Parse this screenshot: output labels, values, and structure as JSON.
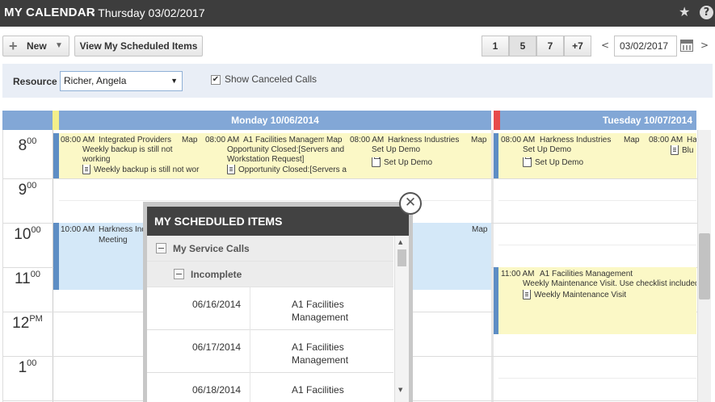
{
  "header": {
    "title": "MY CALENDAR",
    "subtitle": "- Thursday 03/02/2017"
  },
  "toolbar": {
    "new_label": "New",
    "view_scheduled_label": "View My Scheduled Items",
    "day_counts": [
      "1",
      "5",
      "7",
      "+7"
    ],
    "prev": "<",
    "next": ">",
    "date_value": "03/02/2017"
  },
  "filters": {
    "resource_label": "Resource",
    "resource_value": "Richer, Angela",
    "show_canceled_label": "Show Canceled Calls",
    "show_canceled_checked": true
  },
  "calendar": {
    "days": [
      {
        "label": "Monday 10/06/2014",
        "marker_color": "#f3ef8a"
      },
      {
        "label": "Tuesday 10/07/2014",
        "marker_color": "#e74b4b"
      }
    ],
    "hours": [
      {
        "h": "8",
        "s": "00"
      },
      {
        "h": "9",
        "s": "00"
      },
      {
        "h": "10",
        "s": "00"
      },
      {
        "h": "11",
        "s": "00"
      },
      {
        "h": "12",
        "s": "PM"
      },
      {
        "h": "1",
        "s": "00"
      }
    ],
    "events": {
      "mon_a": {
        "time": "08:00 AM",
        "title": "Integrated Providers",
        "desc1": "Weekly backup is still not",
        "desc2": "working",
        "sub": "Weekly backup is still not wor",
        "map": "Map"
      },
      "mon_b": {
        "time": "08:00 AM",
        "title": "A1 Facilities Managem",
        "desc1": "Opportunity Closed:[Servers and",
        "desc2": "Workstation Request]",
        "sub": "Opportunity Closed:[Servers a",
        "map": "Map"
      },
      "mon_c": {
        "time": "08:00 AM",
        "title": "Harkness Industries",
        "desc1": "Set Up Demo",
        "sub": "Set Up Demo",
        "map": "Map"
      },
      "mon_d": {
        "time": "10:00 AM",
        "title": "Harkness Ind",
        "desc1": "Meeting",
        "map": "Map"
      },
      "tue_a": {
        "time": "08:00 AM",
        "title": "Harkness Industries",
        "desc1": "Set Up Demo",
        "sub": "Set Up Demo",
        "map": "Map"
      },
      "tue_b": {
        "time": "08:00 AM",
        "title": "Ha",
        "sub": "Blu"
      },
      "tue_c": {
        "time": "11:00 AM",
        "title": "A1 Facilities Management",
        "desc1": "Weekly Maintenance Visit. Use checklist included",
        "sub": "Weekly Maintenance Visit"
      }
    }
  },
  "popup": {
    "title": "MY SCHEDULED ITEMS",
    "close": "✕",
    "group": "My Service Calls",
    "subgroup": "Incomplete",
    "rows": [
      {
        "date": "06/16/2014",
        "name": "A1 Facilities Management"
      },
      {
        "date": "06/17/2014",
        "name": "A1 Facilities Management"
      },
      {
        "date": "06/18/2014",
        "name": "A1 Facilities"
      }
    ]
  },
  "colors": {
    "appt_yellow": "#fbf8c6",
    "appt_blue": "#d4e8f8",
    "stripe_blue": "#5d8dc4",
    "header_blue": "#82a7d6"
  },
  "icons": [
    "star-icon",
    "help-icon",
    "plus-icon",
    "dropdown-arrow-icon",
    "calendar-icon",
    "document-icon",
    "clipboard-icon",
    "close-icon",
    "minus-icon",
    "scroll-up-icon",
    "scroll-down-icon"
  ]
}
